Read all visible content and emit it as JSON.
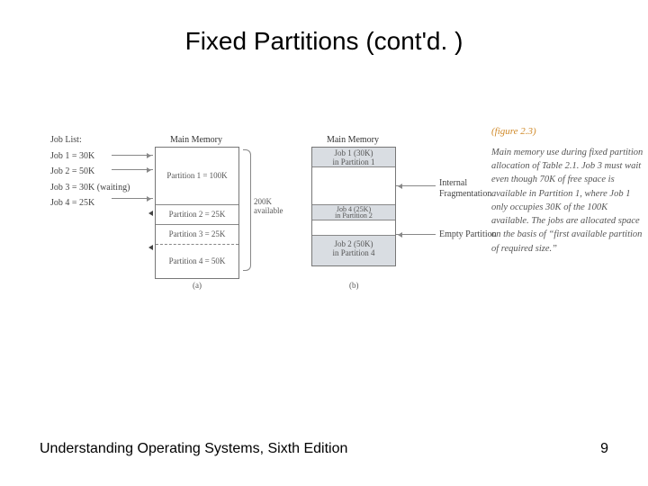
{
  "title": "Fixed Partitions (cont'd. )",
  "footer_left": "Understanding Operating Systems, Sixth Edition",
  "footer_right": "9",
  "figref": "(figure 2.3)",
  "caption": "Main memory use during fixed partition allocation of Table 2.1. Job 3 must wait even though 70K of free space is available in Partition 1, where Job 1 only occupies 30K of the 100K available. The jobs are allocated space on the basis of “first available partition of required size.”",
  "joblist": {
    "header": "Job List:",
    "items": [
      "Job 1 = 30K",
      "Job 2 = 50K",
      "Job 3 = 30K (waiting)",
      "Job 4 = 25K"
    ]
  },
  "colA": {
    "header": "Main Memory",
    "p1": "Partition 1 = 100K",
    "p2": "Partition 2 = 25K",
    "p3": "Partition 3 = 25K",
    "p4": "Partition 4 = 50K",
    "brace": "200K\navailable",
    "caption": "(a)"
  },
  "colB": {
    "header": "Main Memory",
    "s1u_a": "Job 1 (30K)",
    "s1u_b": "in Partition 1",
    "s2u_a": "Job 4 (25K)",
    "s2u_b": "in Partition 2",
    "s4u_a": "Job 2 (50K)",
    "s4u_b": "in Partition 4",
    "caption": "(b)"
  },
  "annot": {
    "frag": "Internal\nFragmentation",
    "empty": "Empty Partition"
  }
}
